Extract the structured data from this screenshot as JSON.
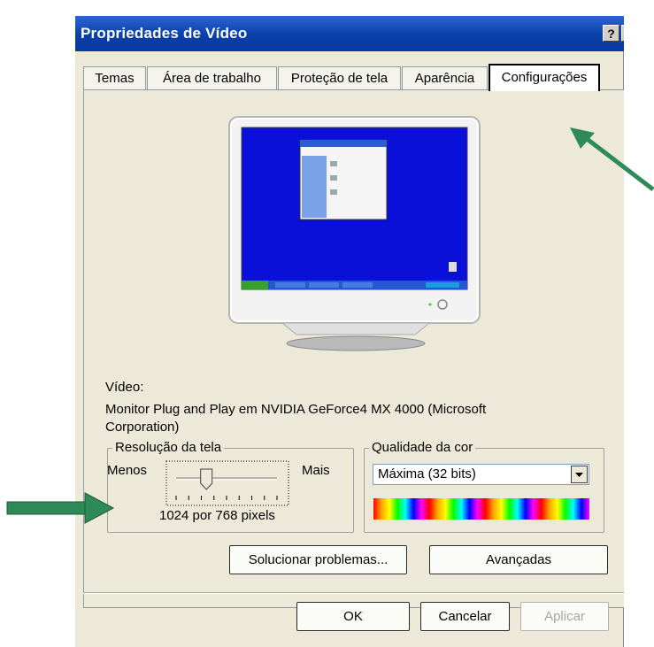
{
  "window": {
    "title": "Propriedades de Vídeo",
    "help_label": "?",
    "close_label": "×"
  },
  "tabs": [
    {
      "label": "Temas"
    },
    {
      "label": "Área de trabalho"
    },
    {
      "label": "Proteção de tela"
    },
    {
      "label": "Aparência"
    },
    {
      "label": "Configurações"
    }
  ],
  "display": {
    "video_label": "Vídeo:",
    "device_line1": "Monitor Plug and Play em NVIDIA GeForce4 MX 4000 (Microsoft",
    "device_line2": "Corporation)"
  },
  "resolution": {
    "group_title": "Resolução da tela",
    "less_label": "Menos",
    "more_label": "Mais",
    "value_text": "1024 por 768 pixels",
    "slider_level": 0.3
  },
  "color_quality": {
    "group_title": "Qualidade da cor",
    "selected": "Máxima (32 bits)"
  },
  "buttons": {
    "troubleshoot": "Solucionar problemas...",
    "advanced": "Avançadas",
    "ok": "OK",
    "cancel": "Cancelar",
    "apply": "Aplicar"
  },
  "colors": {
    "accent": "#0a3fa8",
    "dialog_bg": "#ece9d8",
    "desktop_blue": "#0a10d8",
    "arrow_green": "#2f8a5a"
  }
}
